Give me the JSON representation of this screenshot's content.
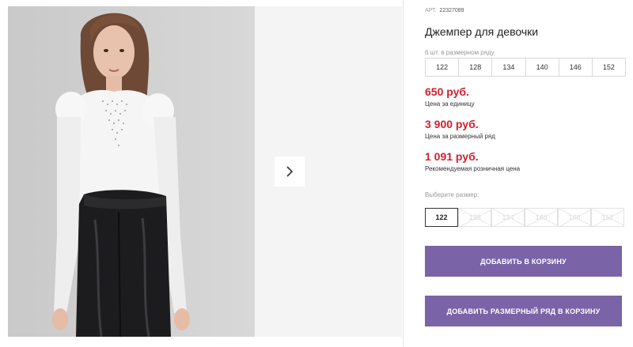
{
  "product": {
    "article_label": "АРТ.",
    "article_number": "22327089",
    "title": "Джемпер для девочки",
    "row_note": "6 шт. в размерном ряду",
    "size_row": [
      "122",
      "128",
      "134",
      "140",
      "146",
      "152"
    ],
    "prices": [
      {
        "value": "650 руб.",
        "label": "Цена за единицу"
      },
      {
        "value": "3 900 руб.",
        "label": "Цена за размерный ряд"
      },
      {
        "value": "1 091 руб.",
        "label": "Рекомендуемая розничная цена"
      }
    ],
    "choose_size_label": "Выберите размер:",
    "size_options": [
      {
        "label": "122",
        "available": true,
        "selected": true
      },
      {
        "label": "128",
        "available": false,
        "selected": false
      },
      {
        "label": "134",
        "available": false,
        "selected": false
      },
      {
        "label": "140",
        "available": false,
        "selected": false
      },
      {
        "label": "146",
        "available": false,
        "selected": false
      },
      {
        "label": "152",
        "available": false,
        "selected": false
      }
    ]
  },
  "actions": {
    "add_to_cart": "ДОБАВИТЬ В КОРЗИНУ",
    "add_row_to_cart": "ДОБАВИТЬ РАЗМЕРНЫЙ РЯД В КОРЗИНУ"
  },
  "colors": {
    "price": "#d11f2d",
    "button": "#7a63a6"
  },
  "icons": {
    "next": "chevron-right-icon"
  }
}
